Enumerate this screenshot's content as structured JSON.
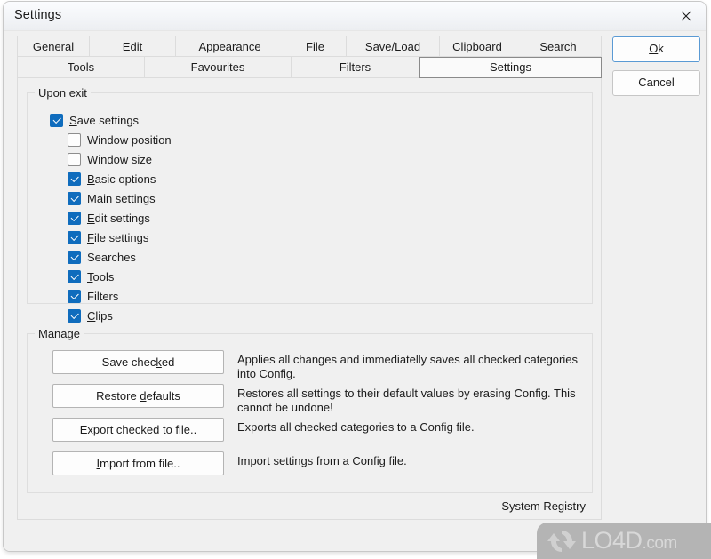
{
  "window": {
    "title": "Settings",
    "close_icon": "close-icon"
  },
  "tabs": {
    "row1": [
      {
        "label": "General",
        "selected": false
      },
      {
        "label": "Edit",
        "selected": false
      },
      {
        "label": "Appearance",
        "selected": false
      },
      {
        "label": "File",
        "selected": false
      },
      {
        "label": "Save/Load",
        "selected": false
      },
      {
        "label": "Clipboard",
        "selected": false
      },
      {
        "label": "Search",
        "selected": false
      }
    ],
    "row2": [
      {
        "label": "Tools",
        "selected": false
      },
      {
        "label": "Favourites",
        "selected": false
      },
      {
        "label": "Filters",
        "selected": false
      },
      {
        "label": "Settings",
        "selected": true
      }
    ]
  },
  "upon_exit": {
    "legend": "Upon exit",
    "items": [
      {
        "label": "Save settings",
        "accel": "S",
        "checked": true,
        "indent": 0
      },
      {
        "label": "Window position",
        "accel": "",
        "checked": false,
        "indent": 1
      },
      {
        "label": "Window size",
        "accel": "",
        "checked": false,
        "indent": 1
      },
      {
        "label": "Basic options",
        "accel": "B",
        "checked": true,
        "indent": 1
      },
      {
        "label": "Main settings",
        "accel": "M",
        "checked": true,
        "indent": 1
      },
      {
        "label": "Edit settings",
        "accel": "E",
        "checked": true,
        "indent": 1
      },
      {
        "label": "File settings",
        "accel": "F",
        "checked": true,
        "indent": 1
      },
      {
        "label": "Searches",
        "accel": "",
        "checked": true,
        "indent": 1
      },
      {
        "label": "Tools",
        "accel": "T",
        "checked": true,
        "indent": 1
      },
      {
        "label": "Filters",
        "accel": "",
        "checked": true,
        "indent": 1
      },
      {
        "label": "Clips",
        "accel": "C",
        "checked": true,
        "indent": 1
      }
    ]
  },
  "manage": {
    "legend": "Manage",
    "rows": [
      {
        "button": "Save checked",
        "accel": "k",
        "description": "Applies all changes and immediatelly saves all checked categories into Config."
      },
      {
        "button": "Restore defaults",
        "accel": "d",
        "description": "Restores all settings to their default values by erasing Config. This cannot be undone!"
      },
      {
        "button": "Export checked to file..",
        "accel": "x",
        "description": "Exports all checked categories to a Config file."
      },
      {
        "button": "Import from file..",
        "accel": "I",
        "description": "Import settings from a Config file."
      }
    ],
    "footer": "System Registry"
  },
  "actions": {
    "ok": "Ok",
    "ok_accel": "O",
    "cancel": "Cancel"
  },
  "watermark": {
    "brand": "LO4D",
    "domain": ".com",
    "logo_icon": "refresh-circle-icon"
  },
  "colors": {
    "accent_check": "#0f6cbd",
    "focus_border": "#5a9ad4",
    "dialog_bg": "#f0f0f0",
    "watermark_bg": "#b4b4b4"
  }
}
